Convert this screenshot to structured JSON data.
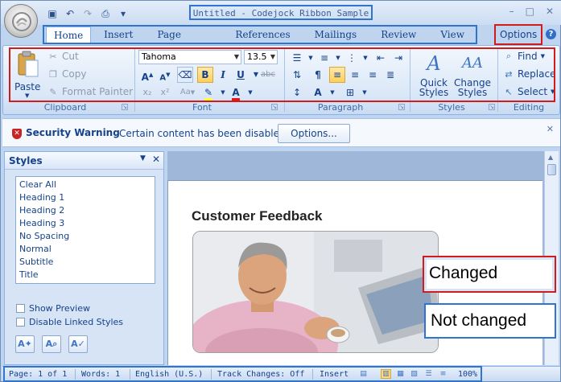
{
  "window": {
    "title": "Untitled - Codejock Ribbon Sample",
    "controls": [
      "–",
      "□",
      "✕"
    ]
  },
  "quick_access": [
    "save-icon",
    "undo-icon",
    "redo-icon",
    "print-icon",
    "customize-icon"
  ],
  "tabs": [
    {
      "label": "Home",
      "active": true
    },
    {
      "label": "Insert"
    },
    {
      "label": "Page Layout"
    },
    {
      "label": "References"
    },
    {
      "label": "Mailings"
    },
    {
      "label": "Review"
    },
    {
      "label": "View"
    }
  ],
  "options_label": "Options",
  "options_arrow": "▾",
  "help_glyph": "?",
  "ribbon": {
    "clipboard": {
      "label": "Clipboard",
      "paste": "Paste",
      "cut": "Cut",
      "copy": "Copy",
      "format_painter": "Format Painter"
    },
    "font": {
      "label": "Font",
      "font_name": "Tahoma",
      "font_size": "13.5",
      "bold": "B",
      "italic": "I",
      "underline": "U",
      "strike": "abc",
      "grow": "A",
      "shrink": "A",
      "case": "Aa",
      "color_letter": "A"
    },
    "paragraph": {
      "label": "Paragraph"
    },
    "styles": {
      "label": "Styles",
      "quick_styles": "Quick Styles",
      "change_styles": "Change Styles"
    },
    "editing": {
      "label": "Editing",
      "find": "Find",
      "replace": "Replace",
      "select": "Select"
    }
  },
  "security": {
    "title": "Security Warning",
    "message": "Certain content has been disabled.",
    "button": "Options..."
  },
  "styles_pane": {
    "title": "Styles",
    "items": [
      "Clear All",
      "Heading 1",
      "Heading 2",
      "Heading 3",
      "No Spacing",
      "Normal",
      "Subtitle",
      "Title"
    ],
    "show_preview": "Show Preview",
    "disable_linked": "Disable Linked Styles"
  },
  "document": {
    "heading": "Customer Feedback"
  },
  "annotations": {
    "changed": "Changed",
    "not_changed": "Not changed"
  },
  "status": {
    "page": "Page: 1 of 1",
    "words": "Words: 1",
    "language": "English (U.S.)",
    "track": "Track Changes: Off",
    "mode": "Insert",
    "zoom": "100%"
  },
  "colors": {
    "changed_outline": "#d01c1c",
    "unchanged_outline": "#2f74d0",
    "ribbon_text": "#15428b"
  }
}
